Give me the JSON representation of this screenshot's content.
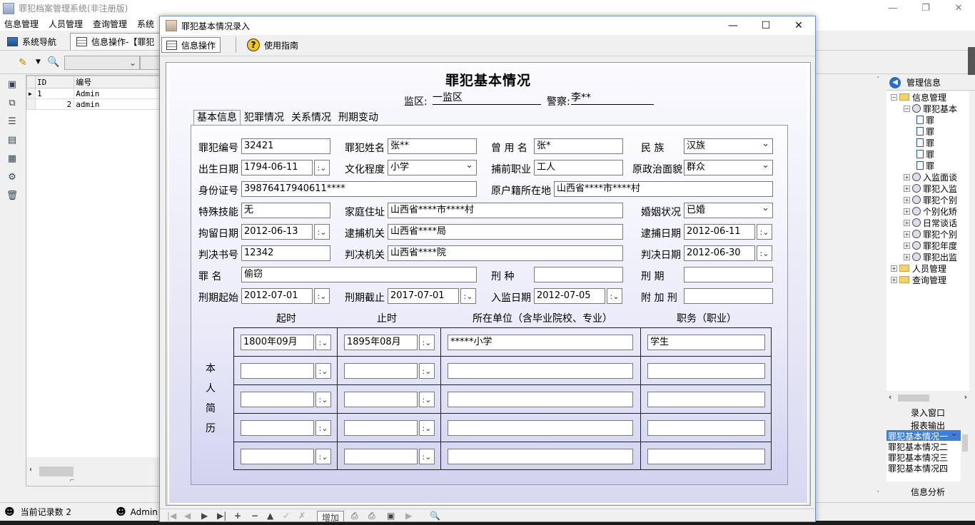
{
  "main": {
    "title": "罪犯档案管理系统(非注册版)",
    "menu": [
      "信息管理",
      "人员管理",
      "查询管理",
      "系统"
    ],
    "tabs": [
      "系统导航",
      "信息操作-【罪犯"
    ],
    "grid": {
      "headers": [
        "ID",
        "编号"
      ],
      "rows": [
        [
          "1",
          "Admin"
        ],
        [
          "2",
          "admin"
        ]
      ]
    },
    "status": {
      "record_count": "当前记录数 2",
      "user": "Admin"
    },
    "window_controls": [
      "—",
      "❐",
      "✕"
    ]
  },
  "right_panel": {
    "header": "管理信息",
    "tree": [
      {
        "text": "信息管理",
        "level": 0,
        "icon": "folder"
      },
      {
        "text": "罪犯基本",
        "level": 1,
        "icon": "node"
      },
      {
        "text": "罪",
        "level": 2,
        "icon": "doc"
      },
      {
        "text": "罪",
        "level": 2,
        "icon": "doc"
      },
      {
        "text": "罪",
        "level": 2,
        "icon": "doc"
      },
      {
        "text": "罪",
        "level": 2,
        "icon": "doc"
      },
      {
        "text": "罪",
        "level": 2,
        "icon": "doc"
      },
      {
        "text": "入监面谈",
        "level": 1,
        "icon": "node"
      },
      {
        "text": "罪犯入监",
        "level": 1,
        "icon": "node"
      },
      {
        "text": "罪犯个别",
        "level": 1,
        "icon": "node"
      },
      {
        "text": "个别化矫",
        "level": 1,
        "icon": "node"
      },
      {
        "text": "日常谈话",
        "level": 1,
        "icon": "node"
      },
      {
        "text": "罪犯个别",
        "level": 1,
        "icon": "node"
      },
      {
        "text": "罪犯年度",
        "level": 1,
        "icon": "node"
      },
      {
        "text": "罪犯出监",
        "level": 1,
        "icon": "node"
      },
      {
        "text": "人员管理",
        "level": 0,
        "icon": "folder"
      },
      {
        "text": "查询管理",
        "level": 0,
        "icon": "folder"
      }
    ],
    "section1": "录入窗口",
    "section2": "报表输出",
    "reports": [
      "罪犯基本情况一",
      "罪犯基本情况二",
      "罪犯基本情况三",
      "罪犯基本情况四"
    ],
    "section3": "信息分析"
  },
  "dialog": {
    "title": "罪犯基本情况录入",
    "controls": [
      "—",
      "☐",
      "✕"
    ],
    "toolbar": {
      "info_ops": "信息操作",
      "guide": "使用指南"
    },
    "form_title": "罪犯基本情况",
    "prison_label": "监区:",
    "prison_value": "一监区",
    "police_label": "警察:",
    "police_value": "李**",
    "tabs": [
      "基本信息",
      "犯罪情况",
      "关系情况",
      "刑期变动"
    ],
    "fields": {
      "id_label": "罪犯编号",
      "id": "32421",
      "name_label": "罪犯姓名",
      "name": "张**",
      "alias_label": "曾 用 名",
      "alias": "张*",
      "ethnic_label": "民    族",
      "ethnic": "汉族",
      "birth_label": "出生日期",
      "birth": "1794-06-11",
      "edu_label": "文化程度",
      "edu": "小学",
      "job_label": "捕前职业",
      "job": "工人",
      "political_label": "原政治面貌",
      "political": "群众",
      "idcard_label": "身份证号",
      "idcard": "39876417940611****",
      "origin_label": "原户籍所在地",
      "origin": "山西省****市****村",
      "skill_label": "特殊技能",
      "skill": "无",
      "address_label": "家庭住址",
      "address": "山西省****市****村",
      "marriage_label": "婚姻状况",
      "marriage": "已婚",
      "detain_label": "拘留日期",
      "detain": "2012-06-13",
      "arrest_org_label": "逮捕机关",
      "arrest_org": "山西省****局",
      "arrest_date_label": "逮捕日期",
      "arrest_date": "2012-06-11",
      "verdict_no_label": "判决书号",
      "verdict_no": "12342",
      "verdict_org_label": "判决机关",
      "verdict_org": "山西省****院",
      "verdict_date_label": "判决日期",
      "verdict_date": "2012-06-30",
      "crime_label": "罪    名",
      "crime": "偷窃",
      "penalty_label": "刑    种",
      "penalty": "",
      "term_label": "刑    期",
      "term": "",
      "term_start_label": "刑期起始",
      "term_start": "2012-07-01",
      "term_end_label": "刑期截止",
      "term_end": "2017-07-01",
      "enter_label": "入监日期",
      "enter": "2012-07-05",
      "extra_label": "附 加 刑",
      "extra": ""
    },
    "history": {
      "headers": [
        "起时",
        "止时",
        "所在单位（含毕业院校、专业）",
        "职务（职业）"
      ],
      "side_label": [
        "本",
        "人",
        "简",
        "历"
      ],
      "rows": [
        [
          "1800年09月",
          "1895年08月",
          "*****小学",
          "学生"
        ],
        [
          "",
          "",
          "",
          ""
        ],
        [
          "",
          "",
          "",
          ""
        ],
        [
          "",
          "",
          "",
          ""
        ],
        [
          "",
          "",
          "",
          ""
        ]
      ]
    },
    "nav": {
      "add_label": "增加"
    }
  }
}
